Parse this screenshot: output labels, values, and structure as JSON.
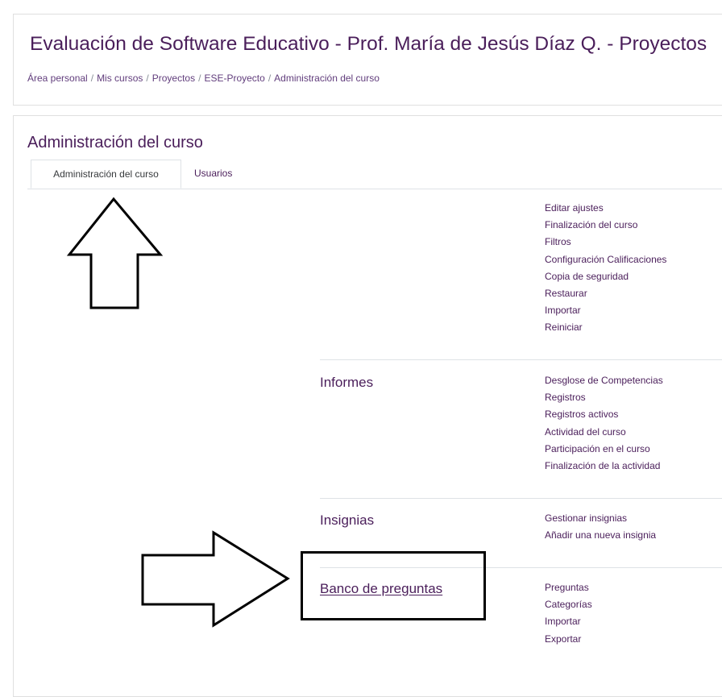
{
  "header": {
    "course_title": "Evaluación de Software Educativo - Prof. María de Jesús Díaz Q. - Proyectos",
    "breadcrumb": [
      "Área personal",
      "Mis cursos",
      "Proyectos",
      "ESE-Proyecto",
      "Administración del curso"
    ],
    "separator": "/"
  },
  "page": {
    "heading": "Administración del curso",
    "tabs": [
      {
        "label": "Administración del curso",
        "active": true
      },
      {
        "label": "Usuarios",
        "active": false
      }
    ]
  },
  "sections": [
    {
      "title": "",
      "links": [
        "Editar ajustes",
        "Finalización del curso",
        "Filtros",
        "Configuración Calificaciones",
        "Copia de seguridad",
        "Restaurar",
        "Importar",
        "Reiniciar"
      ]
    },
    {
      "title": "Informes",
      "links": [
        "Desglose de Competencias",
        "Registros",
        "Registros activos",
        "Actividad del curso",
        "Participación en el curso",
        "Finalización de la actividad"
      ]
    },
    {
      "title": "Insignias",
      "links": [
        "Gestionar insignias",
        "Añadir una nueva insignia"
      ]
    },
    {
      "title": "Banco de preguntas",
      "title_is_link": true,
      "links": [
        "Preguntas",
        "Categorías",
        "Importar",
        "Exportar"
      ]
    }
  ],
  "colors": {
    "title": "#4a1e5a",
    "link": "#4a1e5a",
    "border": "#dee2e6",
    "annotation": "#000000"
  },
  "annotations": [
    "up-arrow",
    "right-arrow",
    "highlight-box"
  ]
}
